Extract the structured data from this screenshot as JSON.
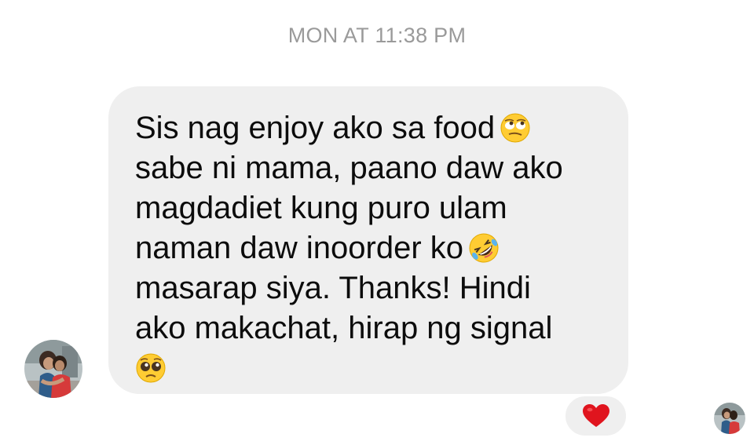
{
  "header": {
    "timestamp": "MON AT 11:38 PM"
  },
  "message": {
    "lines": [
      "Sis nag enjoy ako sa food",
      "sabe ni mama, paano daw ako",
      "magdadiet kung puro ulam",
      "naman daw inoorder ko",
      "masarap siya. Thanks! Hindi",
      "ako makachat, hirap ng signal",
      ""
    ],
    "emojis": [
      "relieved-rolling-eyes-emoji",
      "rolling-on-floor-laughing-emoji",
      "pleading-face-emoji"
    ],
    "bubble_color": "#efefef",
    "text_color": "#0c0c0c"
  },
  "reaction": {
    "icon": "red-heart-icon",
    "color": "#e0141e"
  },
  "sender": {
    "avatar_icon": "profile-photo"
  },
  "seen": {
    "avatar_icon": "seen-profile-photo"
  },
  "colors": {
    "timestamp": "#9a9a9a",
    "background": "#ffffff"
  }
}
